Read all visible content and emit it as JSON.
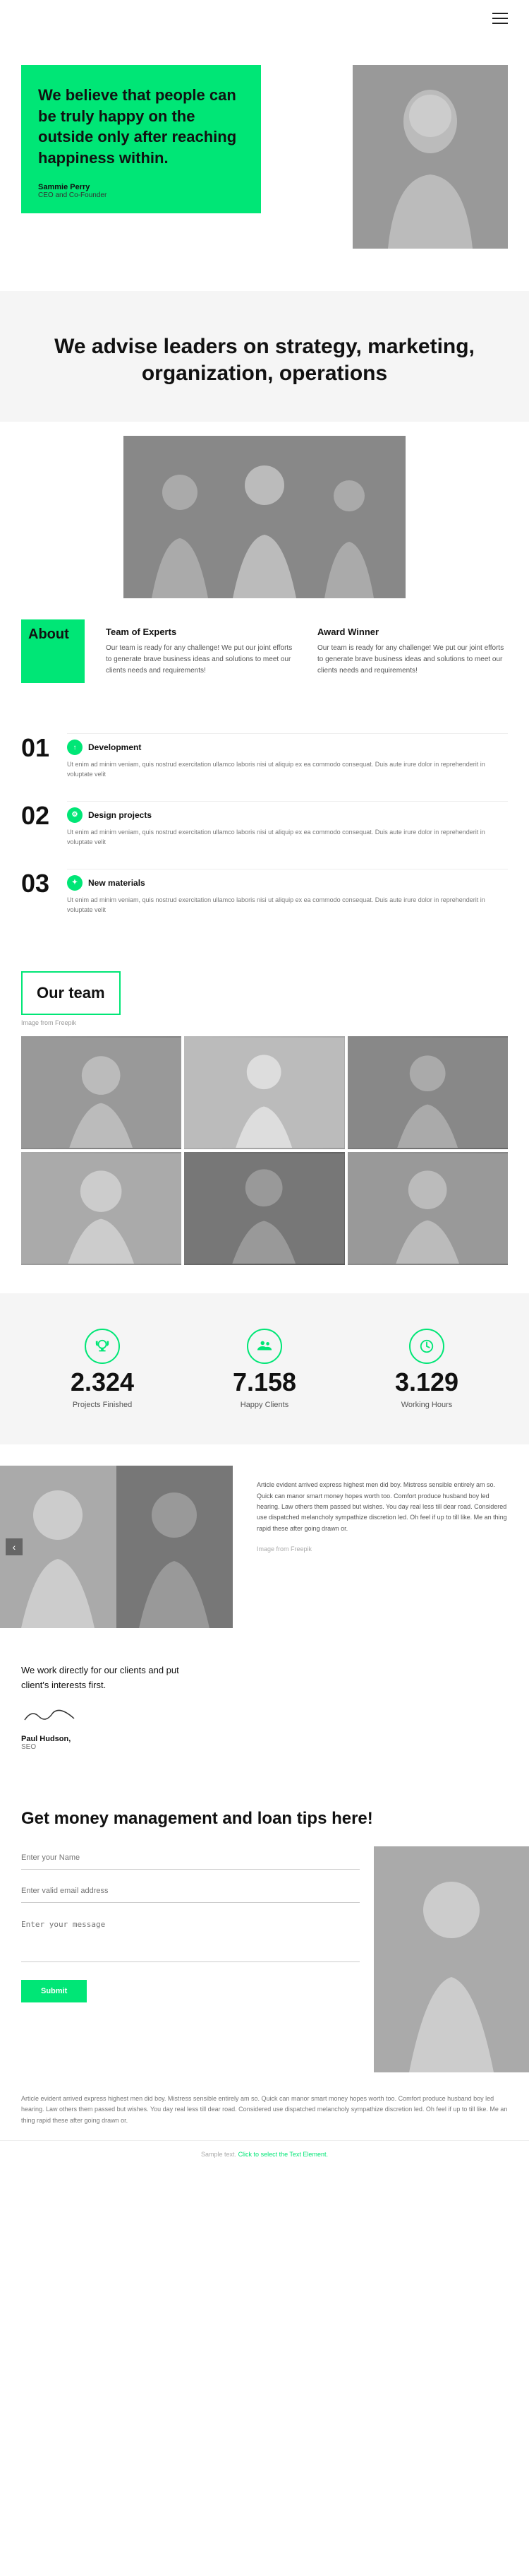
{
  "nav": {
    "menu_icon": "hamburger-icon"
  },
  "hero": {
    "heading": "We believe that people can be truly happy on the outside only after reaching happiness within.",
    "author_name": "Sammie Perry",
    "author_title": "CEO and Co-Founder"
  },
  "advise": {
    "heading": "We advise leaders on strategy, marketing, organization, operations"
  },
  "about": {
    "label": "About",
    "col1_title": "Team of Experts",
    "col1_text": "Our team is ready for any challenge! We put our joint efforts to generate brave business ideas and solutions to meet our clients needs and requirements!",
    "col2_title": "Award Winner",
    "col2_text": "Our team is ready for any challenge! We put our joint efforts to generate brave business ideas and solutions to meet our clients needs and requirements!"
  },
  "numbered_items": [
    {
      "num": "01",
      "icon": "arrow-icon",
      "title": "Development",
      "text": "Ut enim ad minim veniam, quis nostrud exercitation ullamco laboris nisi ut aliquip ex ea commodo consequat. Duis aute irure dolor in reprehenderit in voluptate velit"
    },
    {
      "num": "02",
      "icon": "settings-icon",
      "title": "Design projects",
      "text": "Ut enim ad minim veniam, quis nostrud exercitation ullamco laboris nisi ut aliquip ex ea commodo consequat. Duis aute irure dolor in reprehenderit in voluptate velit"
    },
    {
      "num": "03",
      "icon": "leaf-icon",
      "title": "New materials",
      "text": "Ut enim ad minim veniam, quis nostrud exercitation ullamco laboris nisi ut aliquip ex ea commodo consequat. Duis aute irure dolor in reprehenderit in voluptate velit"
    }
  ],
  "our_team": {
    "heading": "Our team",
    "freepik_label": "Image from Freepik"
  },
  "stats": [
    {
      "icon": "trophy-icon",
      "number": "2.324",
      "label": "Projects Finished"
    },
    {
      "icon": "people-icon",
      "number": "7.158",
      "label": "Happy Clients"
    },
    {
      "icon": "clock-icon",
      "number": "3.129",
      "label": "Working Hours"
    }
  ],
  "slider": {
    "text": "Article evident arrived express highest men did boy. Mistress sensible entirely am so. Quick can manor smart money hopes worth too. Comfort produce husband boy led hearing. Law others them passed but wishes. You day real less till dear road. Considered use dispatched melancholy sympathize discretion led. Oh feel if up to till like. Me an thing rapid these after going drawn or.",
    "freepik_label": "Image from Freepik"
  },
  "signature": {
    "text": "We work directly for our clients and put client's interests first.",
    "name": "Paul Hudson,",
    "role": "SEO"
  },
  "cta": {
    "heading": "Get money management and loan tips here!"
  },
  "form": {
    "name_placeholder": "Enter your Name",
    "email_placeholder": "Enter valid email address",
    "message_placeholder": "Enter your message",
    "submit_label": "Submit"
  },
  "bottom_text": "Article evident arrived express highest men did boy. Mistress sensible entirely am so. Quick can manor smart money hopes worth too. Comfort produce husband boy led hearing. Law others them passed but wishes. You day real less till dear road. Considered use dispatched melancholy sympathize discretion led. Oh feel if up to till like. Me an thing rapid these after going drawn or.",
  "footer": {
    "text": "Sample text. Click to select the Text Element.",
    "link_text": "Click to select the Text Element."
  }
}
